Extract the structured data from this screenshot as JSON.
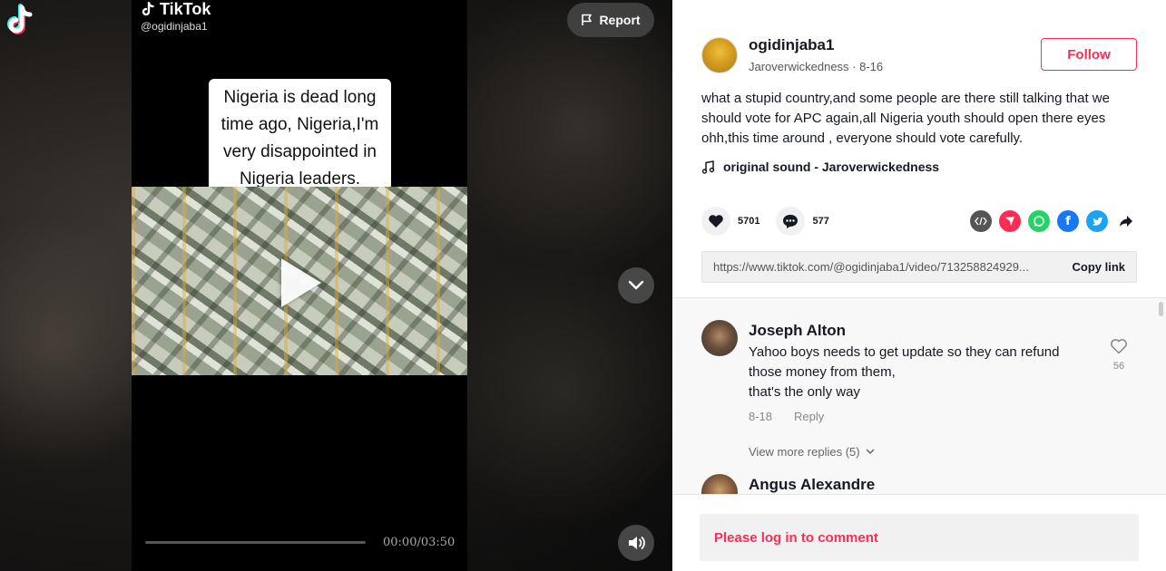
{
  "video": {
    "watermark_brand": "TikTok",
    "watermark_handle": "@ogidinjaba1",
    "caption_text": "Nigeria is dead long time ago, Nigeria,I'm very disappointed in Nigeria leaders.",
    "time": "00:00/03:50",
    "progress_fraction": 0,
    "report_label": "Report"
  },
  "post": {
    "username": "ogidinjaba1",
    "nickname_date": "Jaroverwickedness · 8-16",
    "follow_label": "Follow",
    "description": "what a stupid country,and some people are there still talking that we should vote for APC again,all Nigeria youth should open there eyes ohh,this time around , everyone should vote carefully.",
    "sound": "original sound - Jaroverwickedness",
    "likes": "5701",
    "comments": "577",
    "share_icons": [
      "embed-icon",
      "send-icon",
      "whatsapp-icon",
      "facebook-icon",
      "twitter-icon",
      "share-arrow-icon"
    ],
    "link_url": "https://www.tiktok.com/@ogidinjaba1/video/713258824929...",
    "copy_link_label": "Copy link"
  },
  "comments": [
    {
      "name": "Joseph Alton",
      "text_lines": [
        "Yahoo boys needs to get update so they can refund",
        "those money from them,",
        "that's the only way"
      ],
      "date": "8-18",
      "reply_label": "Reply",
      "likes": "56",
      "more_replies": "View more replies (5)"
    },
    {
      "name": "Angus Alexandre"
    }
  ],
  "login_prompt": "Please log in to comment",
  "colors": {
    "accent": "#fe2c55",
    "facebook": "#1877f2",
    "twitter": "#1da1f2",
    "whatsapp": "#25d366"
  }
}
